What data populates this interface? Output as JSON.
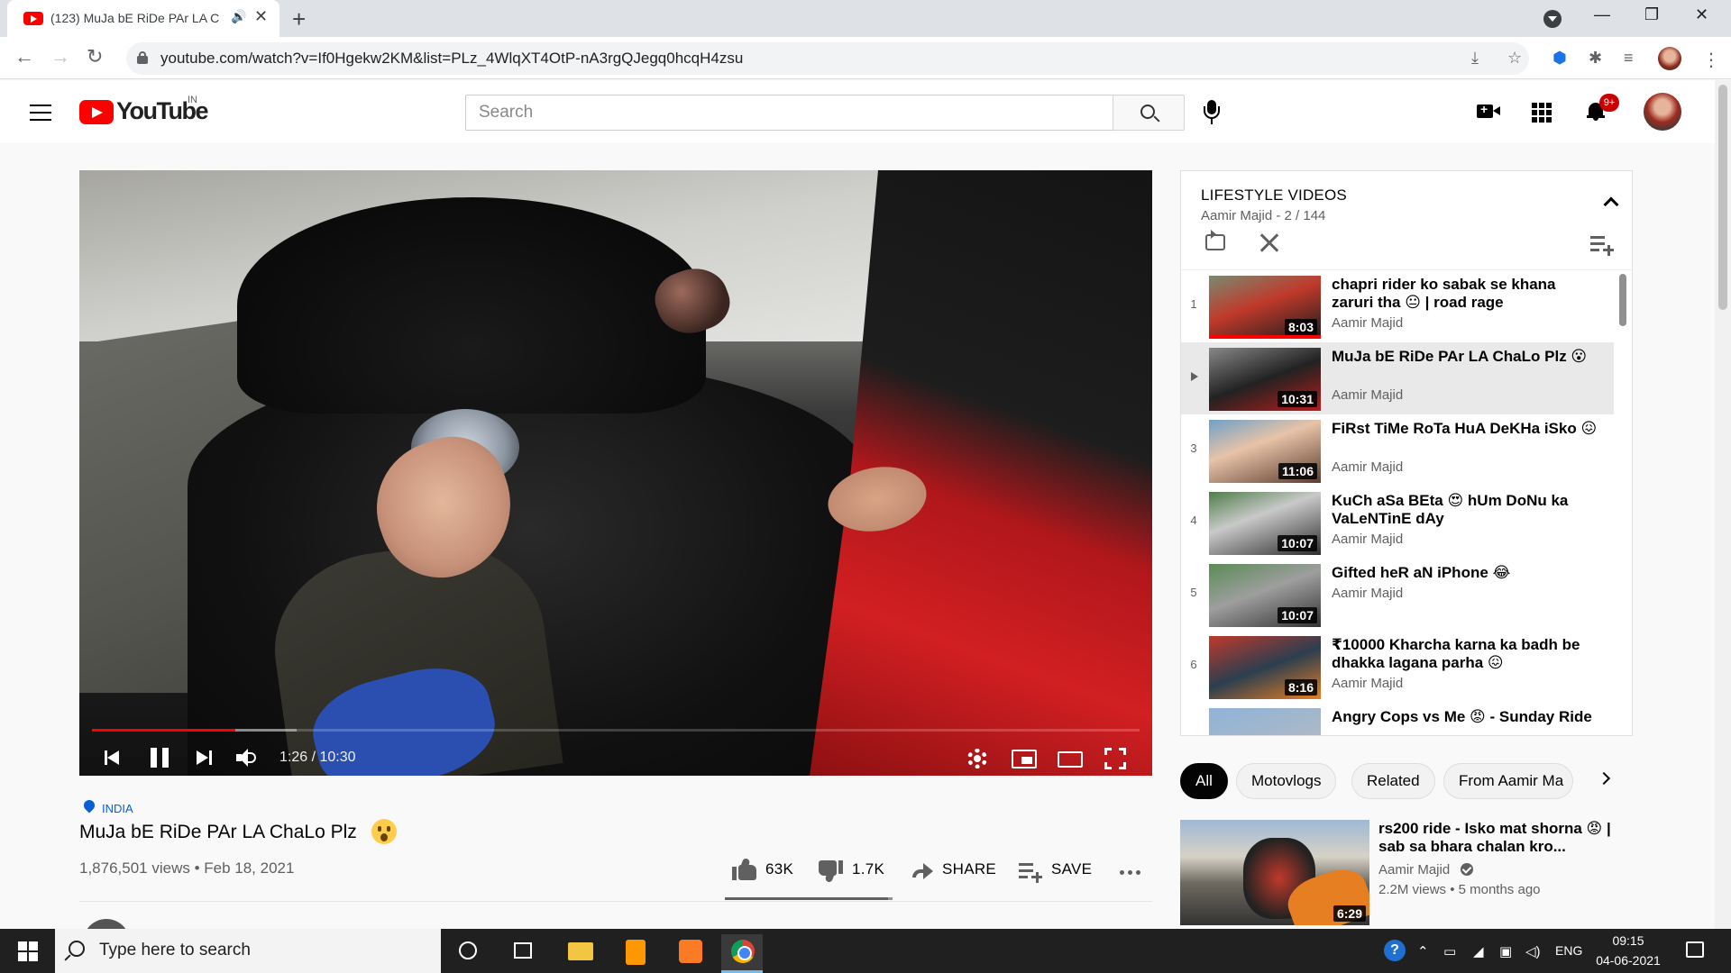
{
  "browser": {
    "tab_title": "(123) MuJa bE RiDe PAr LA C",
    "url": "youtube.com/watch?v=If0Hgekw2KM&list=PLz_4WlqXT4OtP-nA3rgQJegq0hcqH4zsu",
    "new_tab": "+",
    "close_tab": "✕",
    "speaker": "🔊",
    "back": "←",
    "forward": "→",
    "reload": "↻",
    "install": "⤓",
    "star": "☆",
    "ext1": "⬢",
    "ext2": "✱",
    "media": "≡",
    "menu": "⋮",
    "minimize": "—",
    "restore": "❐",
    "close": "✕"
  },
  "youtube": {
    "logo_text": "YouTube",
    "country": "IN",
    "search_placeholder": "Search",
    "notif_count": "9+"
  },
  "player": {
    "time": "1:26 / 10:30",
    "progress_fraction": 0.137,
    "buffer_fraction": 0.195
  },
  "video": {
    "location": "INDIA",
    "title": "MuJa bE RiDe PAr LA ChaLo Plz",
    "stats": "1,876,501 views • Feb 18, 2021",
    "likes": "63K",
    "dislikes": "1.7K",
    "share": "SHARE",
    "save": "SAVE",
    "like_ratio": 0.974
  },
  "playlist": {
    "title": "LIFESTYLE VIDEOS",
    "subtitle": "Aamir Majid - 2 / 144",
    "items": [
      {
        "index": "1",
        "title": "chapri rider ko sabak se khana zaruri tha 😐 | road rage",
        "channel": "Aamir Majid",
        "duration": "8:03"
      },
      {
        "index": "",
        "title": "MuJa bE RiDe PAr LA ChaLo Plz 😮",
        "channel": "Aamir Majid",
        "duration": "10:31"
      },
      {
        "index": "3",
        "title": "FiRst TiMe RoTa HuA DeKHa iSko 😖",
        "channel": "Aamir Majid",
        "duration": "11:06"
      },
      {
        "index": "4",
        "title": "KuCh aSa BEta 😍 hUm DoNu ka VaLeNTinE dAy",
        "channel": "Aamir Majid",
        "duration": "10:07"
      },
      {
        "index": "5",
        "title": "Gifted heR aN iPhone 😂",
        "channel": "Aamir Majid",
        "duration": "10:07"
      },
      {
        "index": "6",
        "title": "₹10000 Kharcha karna ka badh be dhakka lagana parha 😖",
        "channel": "Aamir Majid",
        "duration": "8:16"
      },
      {
        "index": "",
        "title": "Angry Cops vs Me 😡 - Sunday Ride",
        "channel": "",
        "duration": ""
      }
    ]
  },
  "chips": [
    "All",
    "Motovlogs",
    "Related",
    "From Aamir Ma"
  ],
  "recommendation": {
    "title": "rs200 ride - Isko mat shorna 😡 | sab sa bhara chalan kro...",
    "channel": "Aamir Majid",
    "meta": "2.2M views • 5 months ago",
    "duration": "6:29"
  },
  "taskbar": {
    "search_placeholder": "Type here to search",
    "lang": "ENG",
    "time": "09:15",
    "date": "04-06-2021",
    "help": "?"
  },
  "colors": {
    "accent": "#ff0000",
    "link_blue": "#065fd4",
    "taskbar": "#202020"
  }
}
